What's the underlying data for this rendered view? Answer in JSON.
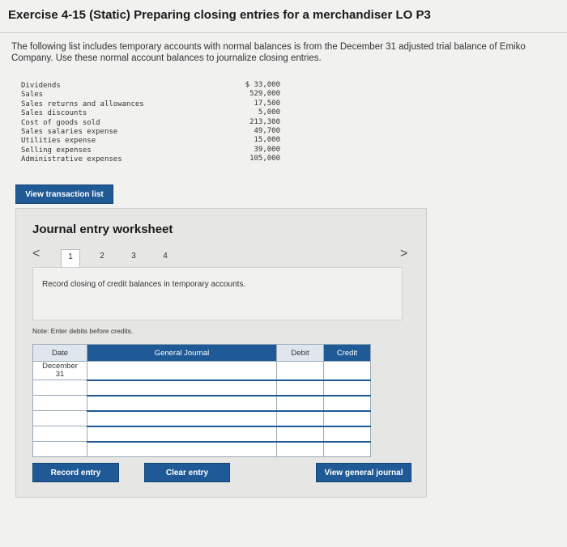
{
  "page": {
    "title": "Exercise 4-15 (Static) Preparing closing entries for a merchandiser LO P3",
    "intro": "The following list includes temporary accounts with normal balances is from the December 31 adjusted trial balance of Emiko Company. Use these normal account balances to journalize closing entries."
  },
  "accounts": [
    {
      "name": "Dividends",
      "amount": "$ 33,000"
    },
    {
      "name": "Sales",
      "amount": "529,000"
    },
    {
      "name": "Sales returns and allowances",
      "amount": "17,500"
    },
    {
      "name": "Sales discounts",
      "amount": "5,000"
    },
    {
      "name": "Cost of goods sold",
      "amount": "213,300"
    },
    {
      "name": "Sales salaries expense",
      "amount": "49,700"
    },
    {
      "name": "Utilities expense",
      "amount": "15,000"
    },
    {
      "name": "Selling expenses",
      "amount": "39,000"
    },
    {
      "name": "Administrative expenses",
      "amount": "105,000"
    }
  ],
  "buttons": {
    "view_transaction_list": "View transaction list",
    "record_entry": "Record entry",
    "clear_entry": "Clear entry",
    "view_general_journal": "View general journal"
  },
  "worksheet": {
    "title": "Journal entry worksheet",
    "prev_glyph": "<",
    "next_glyph": ">",
    "tabs": [
      "1",
      "2",
      "3",
      "4"
    ],
    "description": "Record closing of credit balances in temporary accounts.",
    "note": "Note: Enter debits before credits."
  },
  "journal": {
    "headers": {
      "date": "Date",
      "general_journal": "General Journal",
      "debit": "Debit",
      "credit": "Credit"
    },
    "date_month": "December",
    "date_day": "31"
  }
}
